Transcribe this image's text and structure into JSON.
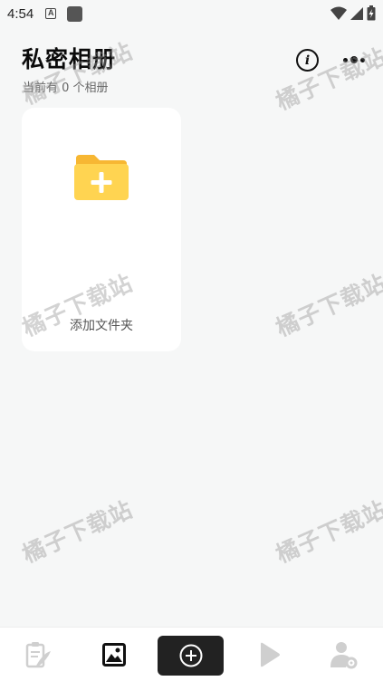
{
  "status_bar": {
    "time": "4:54",
    "notification_letter": "A"
  },
  "header": {
    "title": "私密相册",
    "subtitle": "当前有 0 个相册",
    "info_glyph": "i"
  },
  "card": {
    "label": "添加文件夹"
  },
  "watermark": {
    "text": "橘子下载站"
  },
  "colors": {
    "background": "#f6f7f7",
    "card": "#ffffff",
    "folder_back": "#f7b733",
    "folder_front": "#ffd451",
    "nav_add_bg": "#222222",
    "nav_inactive": "#cfcfcf"
  },
  "bottom_nav": {
    "items": [
      {
        "icon": "notes-icon",
        "active": false
      },
      {
        "icon": "image-icon",
        "active": true
      },
      {
        "icon": "add-circle-icon",
        "active": false
      },
      {
        "icon": "play-icon",
        "active": false
      },
      {
        "icon": "user-settings-icon",
        "active": false
      }
    ]
  }
}
